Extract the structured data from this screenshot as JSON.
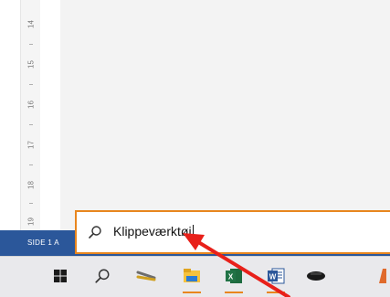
{
  "ruler": {
    "numbers": [
      "14",
      "15",
      "16",
      "17",
      "18",
      "19"
    ]
  },
  "statusbar": {
    "page_label": "SIDE 1 A"
  },
  "search": {
    "query": "Klippeværktøj",
    "icon": "search-icon"
  },
  "taskbar": {
    "items": [
      {
        "icon": "windows-start-icon"
      },
      {
        "icon": "search-icon"
      },
      {
        "icon": "snipping-tool-icon"
      },
      {
        "icon": "file-explorer-icon"
      },
      {
        "icon": "excel-icon"
      },
      {
        "icon": "word-icon"
      },
      {
        "icon": "app-icon"
      },
      {
        "icon": "partial-app-icon"
      }
    ]
  },
  "colors": {
    "status_bar": "#2b579a",
    "highlight": "#e8861e",
    "arrow": "#e8201a",
    "excel": "#217346",
    "word": "#2b579a"
  }
}
